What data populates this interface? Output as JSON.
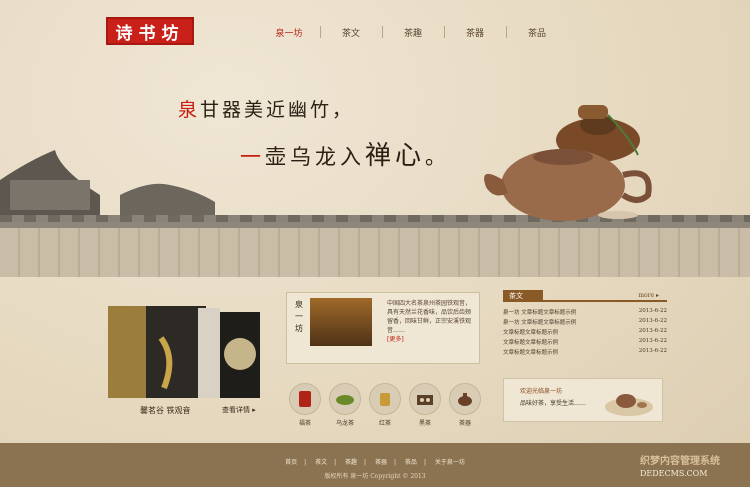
{
  "logo": {
    "text": "诗书坊"
  },
  "nav": {
    "items": [
      {
        "label": "泉一坊"
      },
      {
        "label": "茶文"
      },
      {
        "label": "茶趣"
      },
      {
        "label": "茶器"
      },
      {
        "label": "茶品"
      }
    ]
  },
  "hero": {
    "line1_first": "泉",
    "line1_rest": "甘器美近幽竹，",
    "line2_first": "一",
    "line2_rest": "壶乌龙入",
    "line2_big": "禅心",
    "line2_end": "。"
  },
  "product": {
    "box_text": "铁观音",
    "caption": "馨茗谷 铁观音",
    "more": "查看详情 ▸"
  },
  "shop": {
    "title": "泉一坊",
    "description": "中国四大名茶泉州茶园铁观音，具有天然兰花香味，品饮后齿颊留香，回味甘鲜，正宗安溪铁观音……",
    "link": "[更多]"
  },
  "categories": [
    {
      "label": "福茶",
      "icon": "tea-can-icon"
    },
    {
      "label": "乌龙茶",
      "icon": "tea-cup-icon"
    },
    {
      "label": "红茶",
      "icon": "glass-cup-icon"
    },
    {
      "label": "黑茶",
      "icon": "tea-set-icon"
    },
    {
      "label": "茶器",
      "icon": "teapot-icon"
    }
  ],
  "news": {
    "tab": "茶文",
    "more": "more ▸",
    "items": [
      {
        "title": "泉一坊 文章标题文章标题示例",
        "date": "2013-6-22"
      },
      {
        "title": "泉一坊 文章标题文章标题示例",
        "date": "2013-6-22"
      },
      {
        "title": "文章标题文章标题示例",
        "date": "2013-6-22"
      },
      {
        "title": "文章标题文章标题示例",
        "date": "2013-6-22"
      },
      {
        "title": "文章标题文章标题示例",
        "date": "2013-6-22"
      }
    ]
  },
  "promo": {
    "title": "欢迎光临泉一坊",
    "text": "品味好茶，享受生活……"
  },
  "footer": {
    "links": [
      "首页",
      "茶文",
      "茶趣",
      "茶器",
      "茶品",
      "关于泉一坊"
    ],
    "copyright": "版权所有 泉一坊 Copyright © 2013"
  },
  "watermark": {
    "line1": "织梦内容管理系统",
    "line2": "DEDECMS.COM"
  },
  "colors": {
    "accent_red": "#c81d12",
    "brown": "#8a5a26",
    "footer": "#8b7250",
    "paper": "#e8dcc6"
  }
}
